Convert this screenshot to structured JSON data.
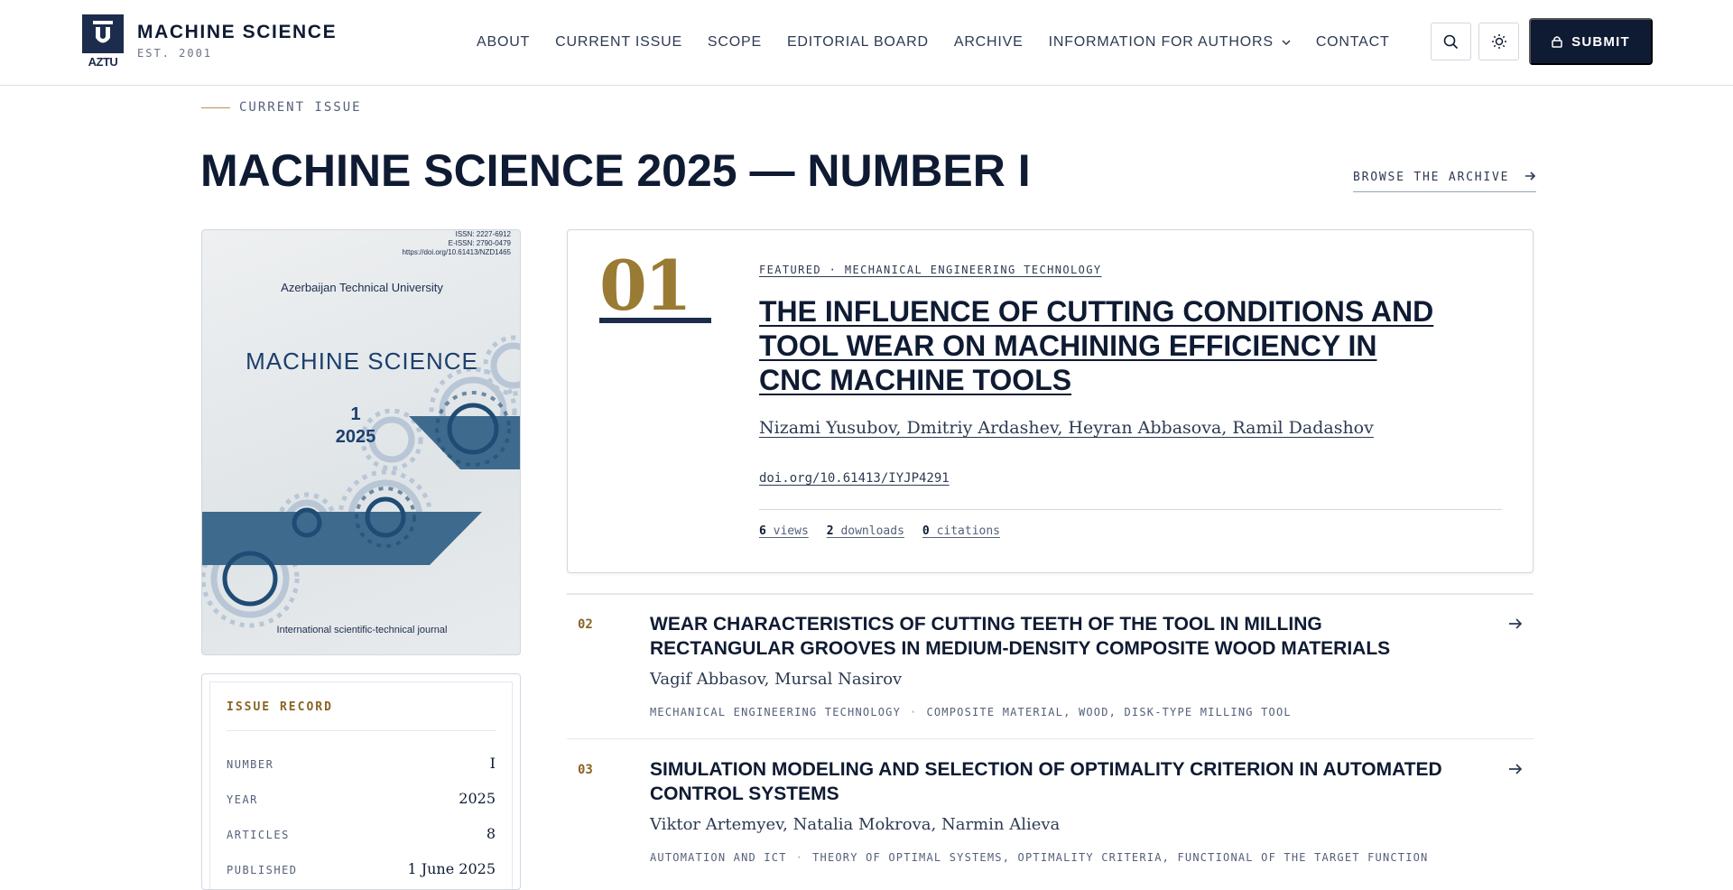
{
  "header": {
    "logo_text": "AZTU",
    "brand_name": "MACHINE SCIENCE",
    "brand_est": "EST. 2001",
    "nav": [
      "ABOUT",
      "CURRENT ISSUE",
      "SCOPE",
      "EDITORIAL BOARD",
      "ARCHIVE",
      "INFORMATION FOR AUTHORS",
      "CONTACT"
    ],
    "search_icon": "search-icon",
    "theme_icon": "sun-icon",
    "submit_label": "SUBMIT",
    "submit_icon": "lock-icon"
  },
  "section": {
    "label": "CURRENT ISSUE",
    "title": "MACHINE SCIENCE 2025 — NUMBER I",
    "browse_label": "BROWSE THE ARCHIVE"
  },
  "cover": {
    "issn": "ISSN: 2227-6912",
    "eissn": "E-ISSN: 2790-0479",
    "doi": "https://doi.org/10.61413/NZD1465",
    "university": "Azerbaijan Technical University",
    "title": "MACHINE SCIENCE",
    "number": "1",
    "year": "2025",
    "footer": "International scientific-technical journal"
  },
  "record": {
    "title": "ISSUE RECORD",
    "rows": [
      {
        "key": "NUMBER",
        "value": "I"
      },
      {
        "key": "YEAR",
        "value": "2025"
      },
      {
        "key": "ARTICLES",
        "value": "8"
      },
      {
        "key": "PUBLISHED",
        "value": "1 June 2025"
      }
    ]
  },
  "featured": {
    "number": "01",
    "category": "FEATURED · MECHANICAL ENGINEERING TECHNOLOGY",
    "title": "THE INFLUENCE OF CUTTING CONDITIONS AND TOOL WEAR ON MACHINING EFFICIENCY IN CNC MACHINE TOOLS",
    "authors": "Nizami Yusubov, Dmitriy Ardashev, Heyran Abbasova, Ramil Dadashov",
    "doi": "doi.org/10.61413/IYJP4291",
    "stats": {
      "views_count": "6",
      "views_label": "views",
      "downloads_count": "2",
      "downloads_label": "downloads",
      "citations_count": "0",
      "citations_label": "citations"
    }
  },
  "articles": [
    {
      "number": "02",
      "title": "WEAR CHARACTERISTICS OF CUTTING TEETH OF THE TOOL IN MILLING RECTANGULAR GROOVES IN MEDIUM-DENSITY COMPOSITE WOOD MATERIALS",
      "authors": "Vagif Abbasov, Mursal Nasirov",
      "category": "MECHANICAL ENGINEERING TECHNOLOGY",
      "keywords": "COMPOSITE MATERIAL, WOOD, DISK-TYPE MILLING TOOL"
    },
    {
      "number": "03",
      "title": "SIMULATION MODELING AND SELECTION OF OPTIMALITY CRITERION IN AUTOMATED CONTROL SYSTEMS",
      "authors": "Viktor Artemyev, Natalia Mokrova, Narmin Alieva",
      "category": "AUTOMATION AND ICT",
      "keywords": "THEORY OF OPTIMAL SYSTEMS, OPTIMALITY CRITERIA, FUNCTIONAL OF THE TARGET FUNCTION"
    }
  ],
  "colors": {
    "navy": "#0f1b33",
    "gold": "#9a7b34",
    "cover_blue": "#3e6a8e"
  }
}
